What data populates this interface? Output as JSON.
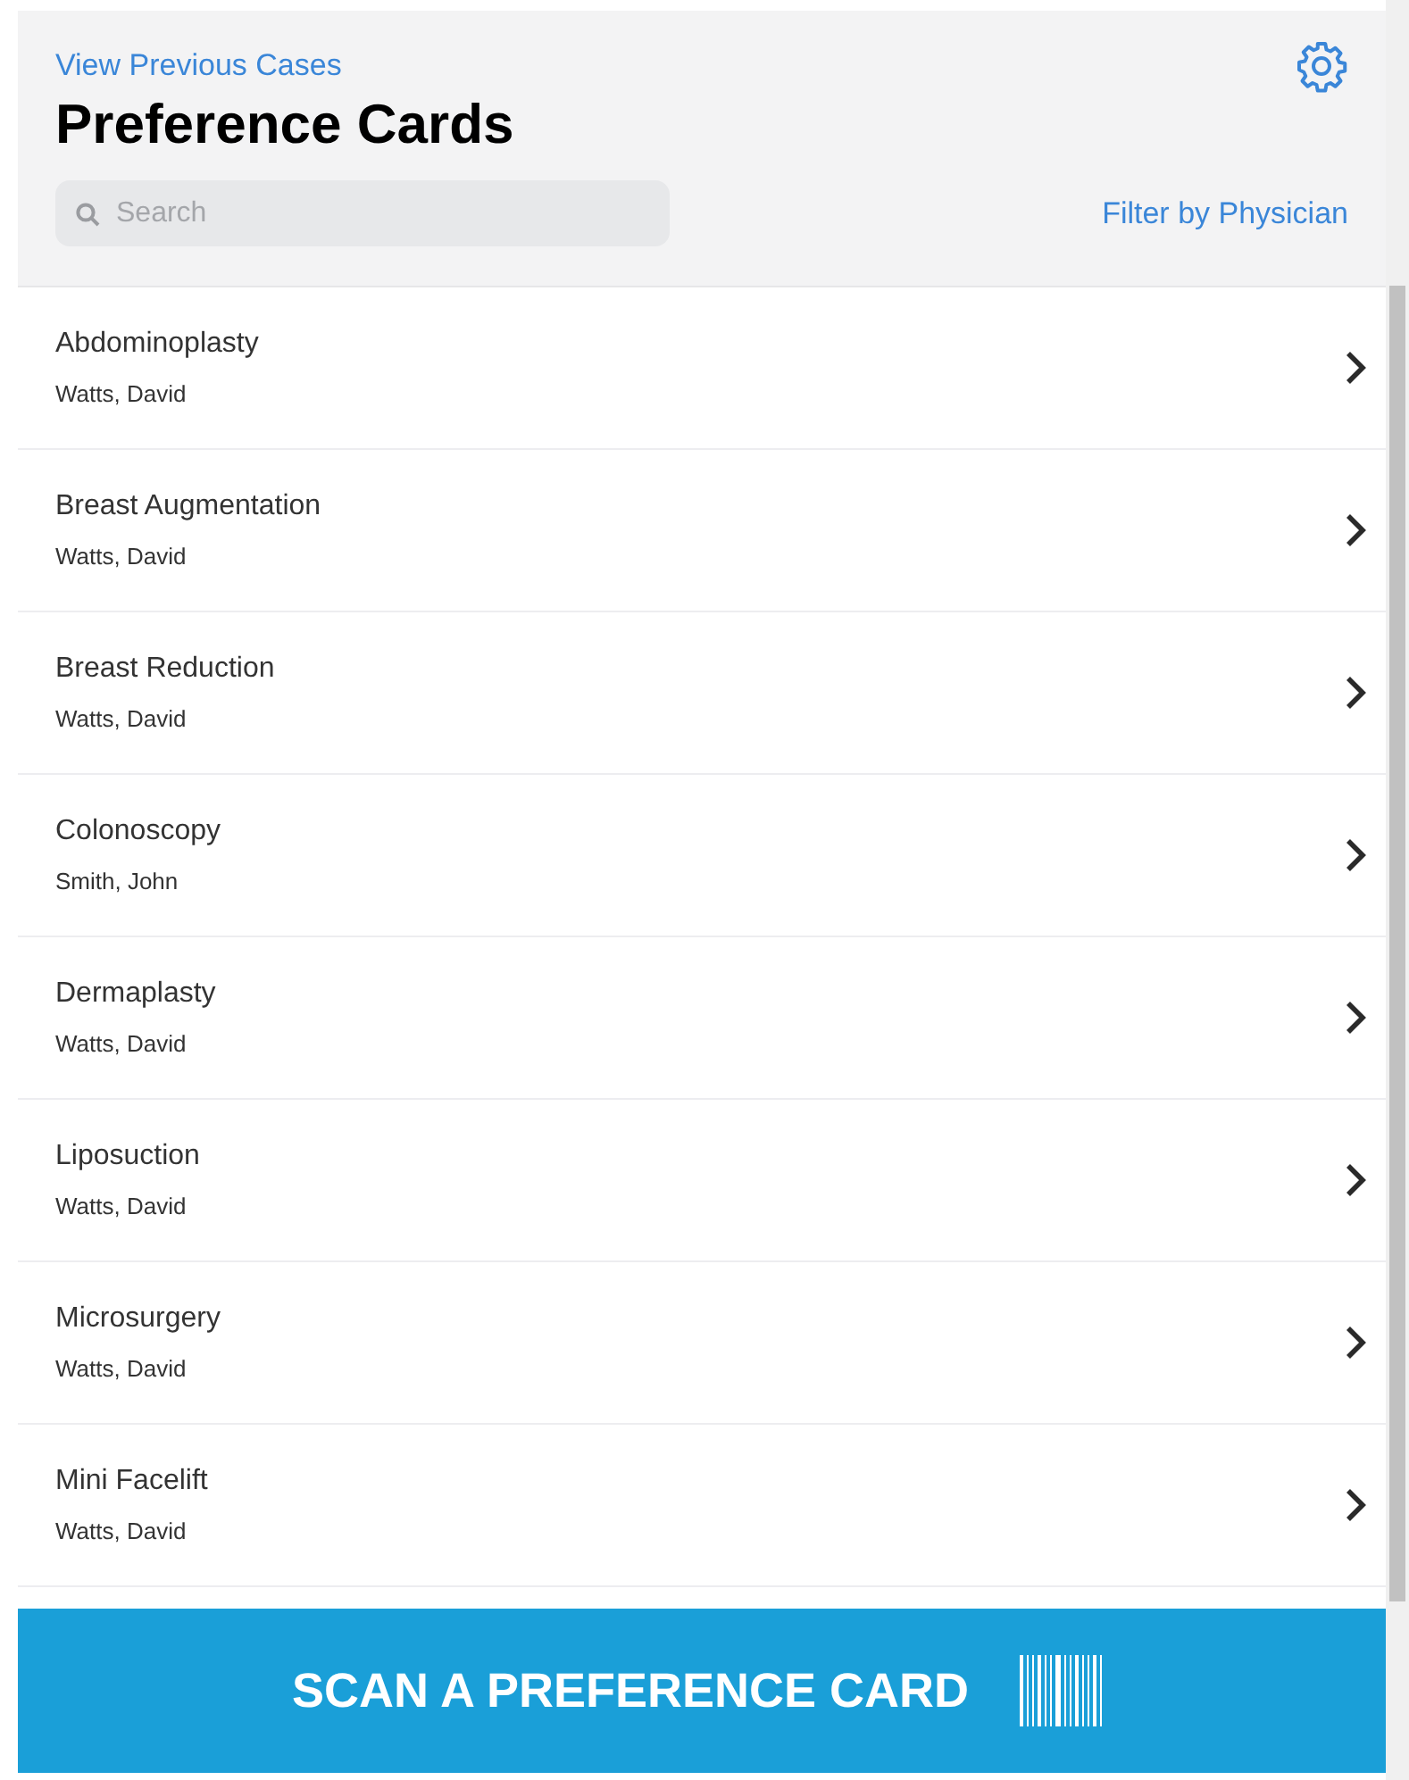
{
  "header": {
    "back_link": "View Previous Cases",
    "title": "Preference Cards",
    "search": {
      "placeholder": "Search"
    },
    "filter_link": "Filter by Physician"
  },
  "cards": [
    {
      "procedure": "Abdominoplasty",
      "physician": "Watts, David"
    },
    {
      "procedure": "Breast Augmentation",
      "physician": "Watts, David"
    },
    {
      "procedure": "Breast Reduction",
      "physician": "Watts, David"
    },
    {
      "procedure": "Colonoscopy",
      "physician": "Smith, John"
    },
    {
      "procedure": "Dermaplasty",
      "physician": "Watts, David"
    },
    {
      "procedure": "Liposuction",
      "physician": "Watts, David"
    },
    {
      "procedure": "Microsurgery",
      "physician": "Watts, David"
    },
    {
      "procedure": "Mini Facelift",
      "physician": "Watts, David"
    }
  ],
  "scan_button": "SCAN A PREFERENCE CARD"
}
